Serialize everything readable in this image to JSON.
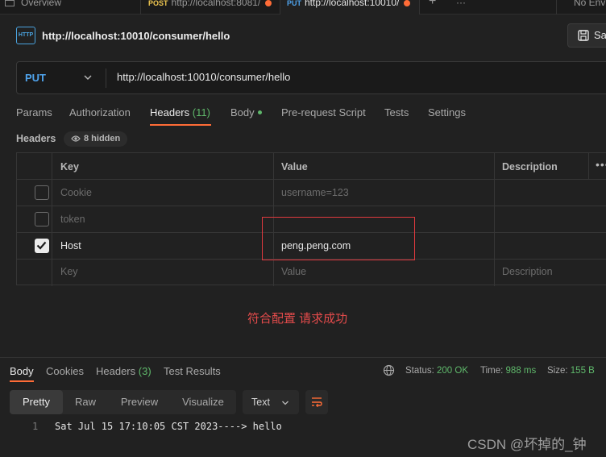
{
  "top_tabs": [
    {
      "method": "",
      "label": "Overview"
    },
    {
      "method": "POST",
      "label": "http://localhost:8081/"
    },
    {
      "method": "PUT",
      "label": "http://localhost:10010/"
    },
    {
      "method": "",
      "label": "+"
    },
    {
      "method": "",
      "label": "···"
    },
    {
      "method": "",
      "label": "No Envi"
    }
  ],
  "request": {
    "icon_text": "HTTP",
    "title": "http://localhost:10010/consumer/hello",
    "save_label": "Sa",
    "method": "PUT",
    "url": "http://localhost:10010/consumer/hello"
  },
  "request_tabs": {
    "params": "Params",
    "authorization": "Authorization",
    "headers": "Headers",
    "headers_count": "(11)",
    "body": "Body",
    "prerequest": "Pre-request Script",
    "tests": "Tests",
    "settings": "Settings"
  },
  "headers_section": {
    "label": "Headers",
    "hidden": "8 hidden"
  },
  "table": {
    "columns": {
      "key": "Key",
      "value": "Value",
      "description": "Description",
      "more": "•••"
    },
    "rows": [
      {
        "checked": false,
        "key": "Cookie",
        "value": "username=123",
        "description": ""
      },
      {
        "checked": false,
        "key": "token",
        "value": "",
        "description": ""
      },
      {
        "checked": true,
        "key": "Host",
        "value": "peng.peng.com",
        "description": ""
      }
    ],
    "placeholder": {
      "key": "Key",
      "value": "Value",
      "description": "Description"
    }
  },
  "annotation": "符合配置 请求成功",
  "response": {
    "tabs": {
      "body": "Body",
      "cookies": "Cookies",
      "headers": "Headers",
      "headers_count": "(3)",
      "test_results": "Test Results"
    },
    "status_label": "Status:",
    "status_value": "200 OK",
    "time_label": "Time:",
    "time_value": "988 ms",
    "size_label": "Size:",
    "size_value": "155 B",
    "formats": [
      "Pretty",
      "Raw",
      "Preview",
      "Visualize"
    ],
    "text_type": "Text",
    "line_number": "1",
    "body": "Sat Jul 15 17:10:05 CST 2023----> hello"
  },
  "watermark": "CSDN @坏掉的_钟",
  "colors": {
    "accent": "#ff6c37",
    "success": "#5fb86b",
    "method_put": "#4fa3ec",
    "annotation": "#e34b4b"
  }
}
